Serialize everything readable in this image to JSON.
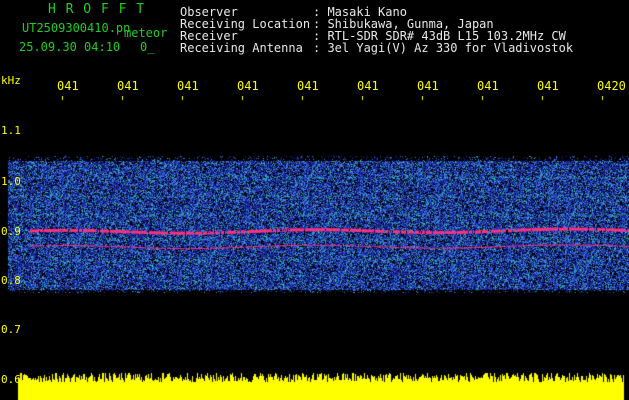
{
  "station": "H R O F F T",
  "filename": "UT2509300410.pn",
  "category": "meteor",
  "datetime": "25.09.30 04:10",
  "count": "0_",
  "info": [
    {
      "label": "Observer",
      "value": ": Masaki Kano"
    },
    {
      "label": "Receiving Location",
      "value": ": Shibukawa, Gunma, Japan"
    },
    {
      "label": "Receiver",
      "value": ": RTL-SDR SDR# 43dB L15 103.2MHz CW"
    },
    {
      "label": "Receiving Antenna",
      "value": ": 3el Yagi(V) Az 330 for Vladivostok"
    }
  ],
  "y_unit": "kHz",
  "y_ticks": [
    "1.1",
    "1.0",
    "0.9",
    "0.8",
    "0.7",
    "0.6"
  ],
  "time_ticks": [
    "041",
    "041",
    "041",
    "041",
    "041",
    "041",
    "041",
    "041",
    "041",
    "0420"
  ],
  "chart_data": {
    "type": "heatmap",
    "y_unit": "kHz",
    "y_ticks": [
      1.1,
      1.0,
      0.9,
      0.8,
      0.7,
      0.6
    ],
    "ylim": [
      0.6,
      1.16
    ],
    "signal_band_khz": [
      0.78,
      1.02
    ],
    "carrier_khz": [
      0.89,
      0.86
    ],
    "colors": {
      "background": "#000000",
      "noise_low": "#1a2aa0",
      "noise_mid": "#3a7adc",
      "noise_high": "#2ec8a0",
      "carrier": "#ff3080",
      "level": "#ffff00",
      "tick": "#ffff00"
    }
  }
}
